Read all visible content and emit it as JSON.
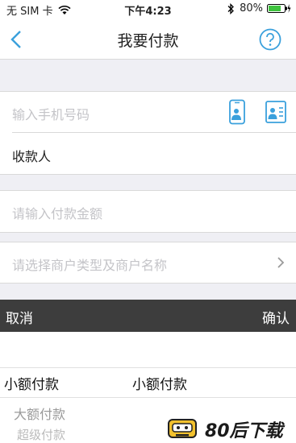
{
  "status": {
    "carrier": "无 SIM 卡",
    "time": "下午4:23",
    "battery": "80%"
  },
  "nav": {
    "title": "我要付款"
  },
  "form": {
    "phone_placeholder": "输入手机号码",
    "payee_label": "收款人",
    "amount_placeholder": "请输入付款金额",
    "merchant_placeholder": "请选择商户类型及商户名称"
  },
  "picker": {
    "cancel": "取消",
    "confirm": "确认",
    "selected_col1": "小额付款",
    "selected_col2": "小额付款",
    "option_1": "大额付款",
    "option_2": "超级付款"
  },
  "watermark": {
    "text": "80后下载"
  },
  "colors": {
    "accent": "#3aa0dc",
    "toolbar": "#3d3d3d",
    "background": "#efeff4"
  }
}
